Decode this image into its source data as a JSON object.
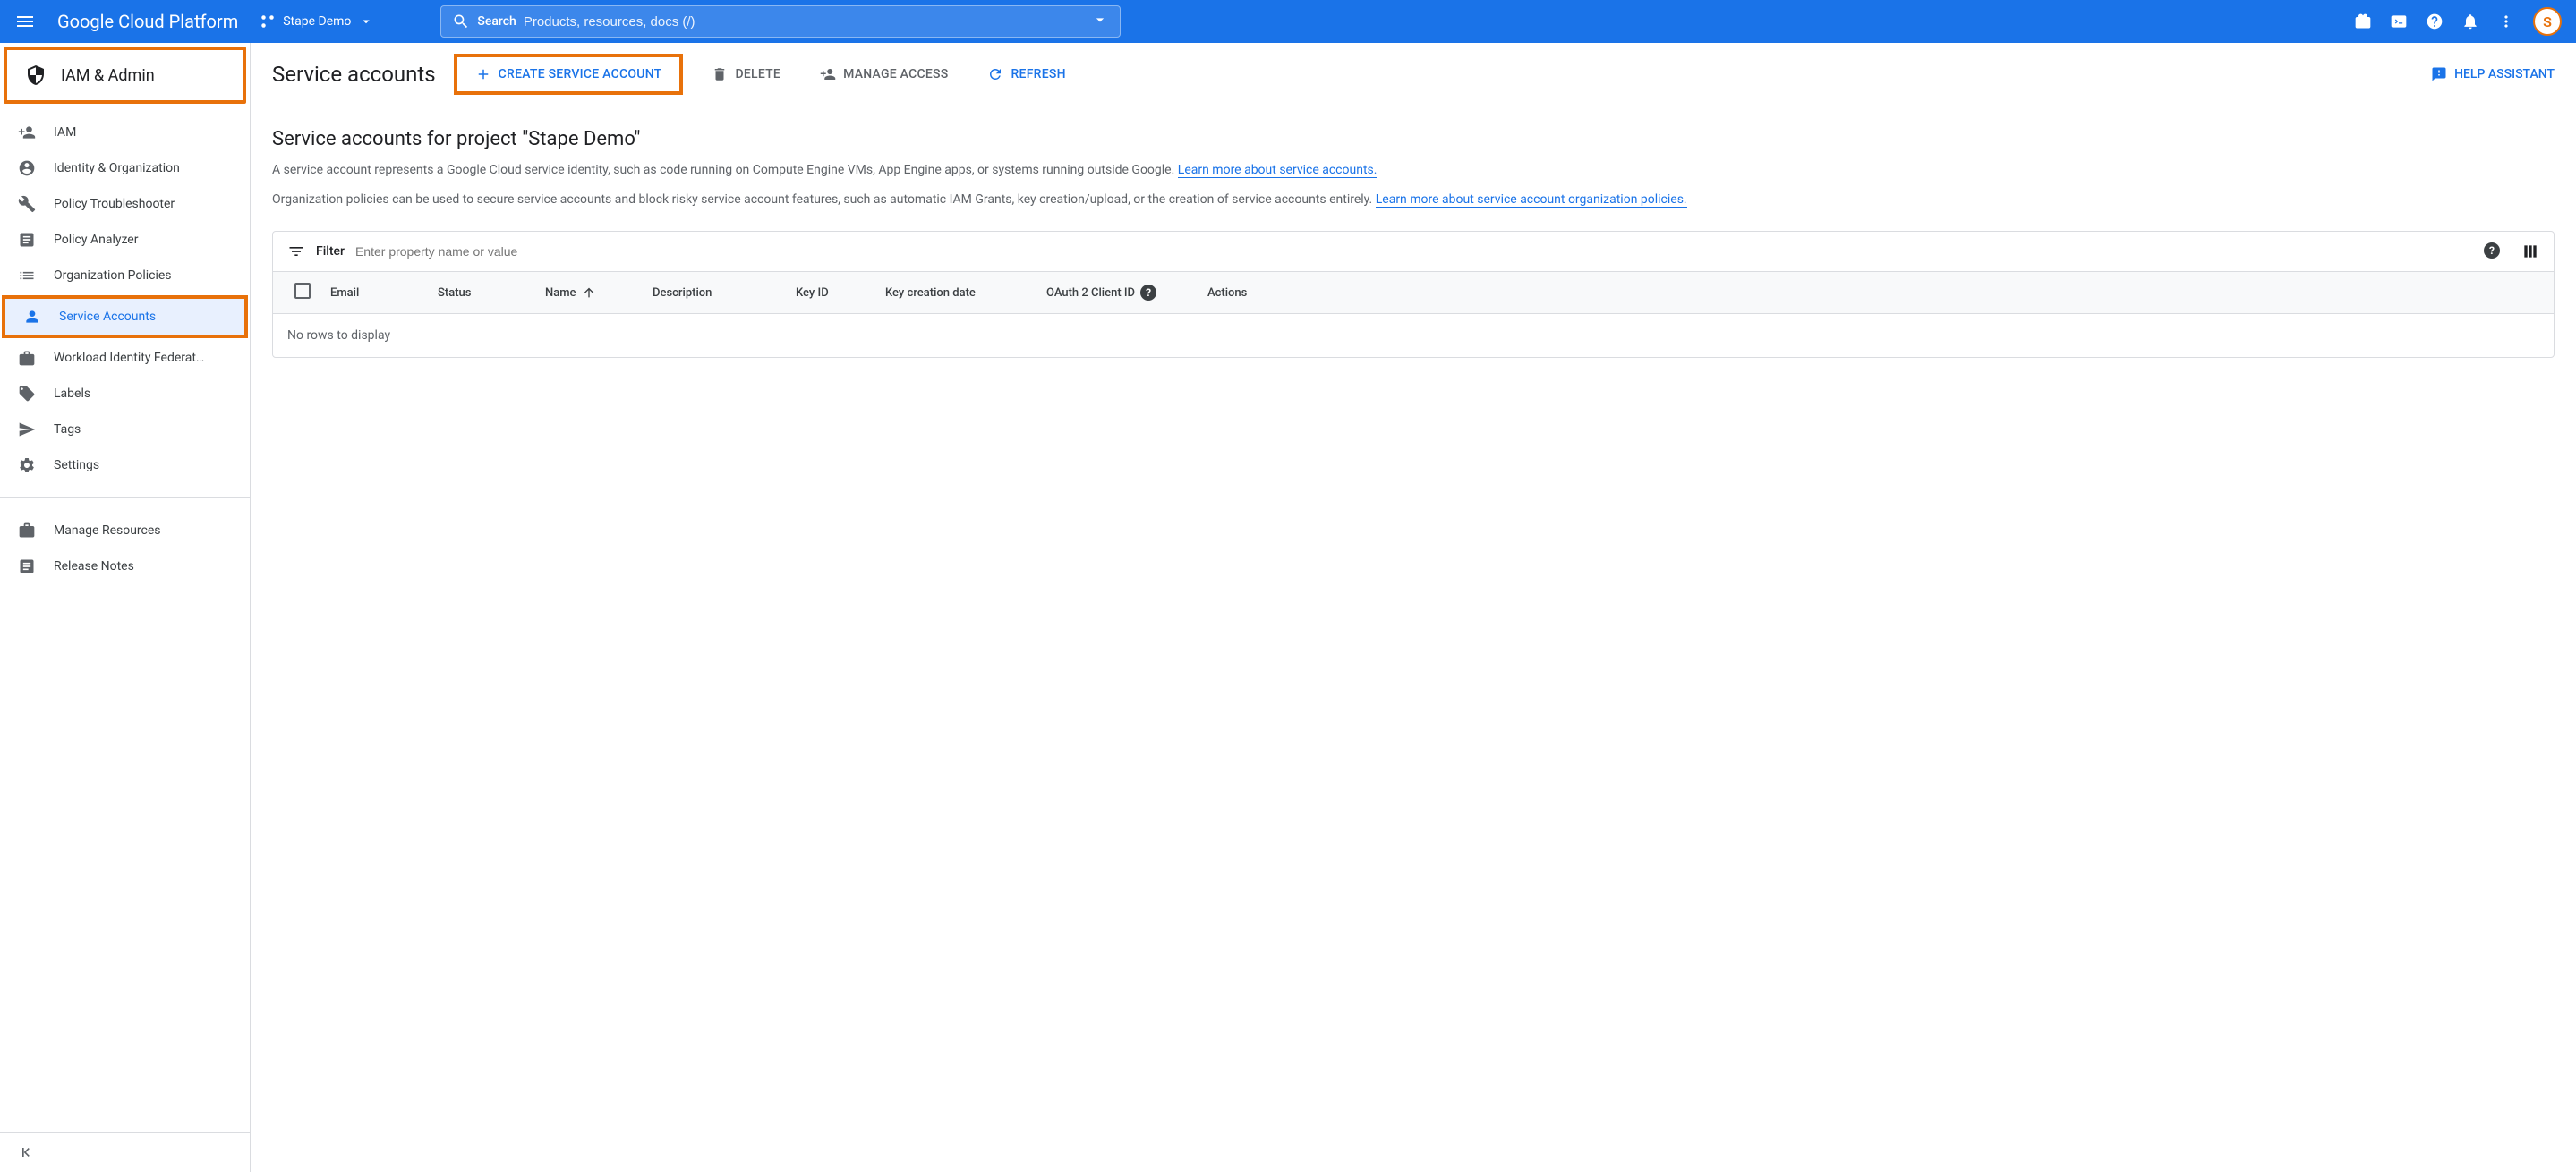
{
  "header": {
    "logo_text": "Google Cloud Platform",
    "project_name": "Stape Demo",
    "search_label": "Search",
    "search_placeholder": "Products, resources, docs (/)",
    "avatar_letter": "S"
  },
  "sidebar": {
    "title": "IAM & Admin",
    "items": [
      {
        "label": "IAM",
        "icon": "person-add"
      },
      {
        "label": "Identity & Organization",
        "icon": "account"
      },
      {
        "label": "Policy Troubleshooter",
        "icon": "wrench"
      },
      {
        "label": "Policy Analyzer",
        "icon": "document-search"
      },
      {
        "label": "Organization Policies",
        "icon": "list"
      },
      {
        "label": "Service Accounts",
        "icon": "key-account",
        "active": true
      },
      {
        "label": "Workload Identity Federat…",
        "icon": "badge"
      },
      {
        "label": "Labels",
        "icon": "tag"
      },
      {
        "label": "Tags",
        "icon": "send"
      },
      {
        "label": "Settings",
        "icon": "gear"
      }
    ],
    "footer_items": [
      {
        "label": "Manage Resources",
        "icon": "briefcase"
      },
      {
        "label": "Release Notes",
        "icon": "notes"
      }
    ]
  },
  "content": {
    "page_title": "Service accounts",
    "actions": {
      "create": "CREATE SERVICE ACCOUNT",
      "delete": "DELETE",
      "manage": "MANAGE ACCESS",
      "refresh": "REFRESH"
    },
    "help_assistant": "HELP ASSISTANT",
    "subtitle": "Service accounts for project \"Stape Demo\"",
    "desc1_text": "A service account represents a Google Cloud service identity, such as code running on Compute Engine VMs, App Engine apps, or systems running outside Google. ",
    "desc1_link": "Learn more about service accounts.",
    "desc2_text": "Organization policies can be used to secure service accounts and block risky service account features, such as automatic IAM Grants, key creation/upload, or the creation of service accounts entirely. ",
    "desc2_link": "Learn more about service account organization policies.",
    "table": {
      "filter_label": "Filter",
      "filter_placeholder": "Enter property name or value",
      "columns": {
        "email": "Email",
        "status": "Status",
        "name": "Name",
        "description": "Description",
        "keyid": "Key ID",
        "keydate": "Key creation date",
        "oauth": "OAuth 2 Client ID",
        "actions": "Actions"
      },
      "empty_text": "No rows to display"
    }
  }
}
